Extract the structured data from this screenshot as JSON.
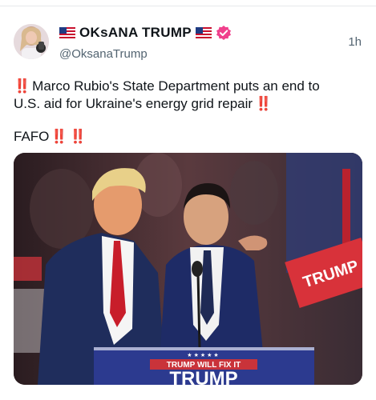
{
  "post": {
    "author_flag_left": "us-flag",
    "display_name": "OKsANA TRUMP",
    "author_flag_right": "us-flag",
    "verified_badge": "verified-badge-icon",
    "handle": "@OksanaTrump",
    "timestamp": "1h",
    "text_line1": "Marco Rubio's State Department puts an end to",
    "text_line2": "U.S. aid for Ukraine's energy grid repair",
    "text_emphasis": "‼️",
    "fafo": "FAFO",
    "media": {
      "podium_top": "TRUMP WILL FIX IT",
      "podium_main": "TRUMP",
      "sign_text": "TRUMP"
    }
  },
  "colors": {
    "verified": "#f0408c",
    "emphasis": "#e02424",
    "podium": "#2c3a8f",
    "podium_banner": "#c9333a"
  }
}
